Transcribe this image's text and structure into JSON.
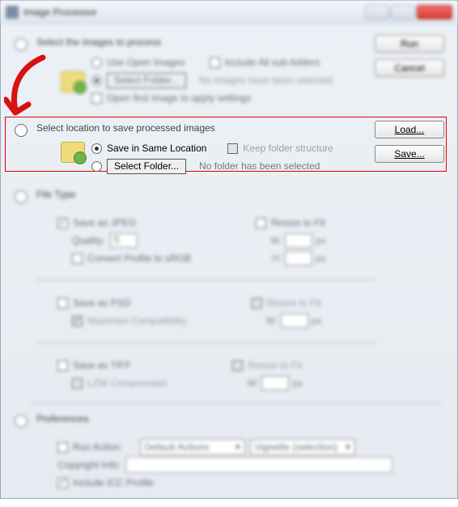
{
  "window": {
    "title": "Image Processor"
  },
  "side_buttons": {
    "run": "Run",
    "cancel": "Cancel",
    "load": "Load...",
    "save": "Save..."
  },
  "section1": {
    "title": "Select the images to process",
    "use_open_images": "Use Open Images",
    "include_subfolders": "Include All sub-folders",
    "select_folder_btn": "Select Folder...",
    "no_images": "No images have been selected",
    "open_first_image": "Open first image to apply settings"
  },
  "section2": {
    "title": "Select location to save processed images",
    "same_location": "Save in Same Location",
    "keep_folder": "Keep folder structure",
    "select_folder_btn": "Select Folder...",
    "no_folder": "No folder has been selected"
  },
  "section3": {
    "title": "File Type",
    "save_jpeg": "Save as JPEG",
    "quality_label": "Quality:",
    "quality_value": "5",
    "convert_profile": "Convert Profile to sRGB",
    "resize_fit": "Resize to Fit",
    "w_label": "W:",
    "h_label": "H:",
    "px": "px",
    "save_psd": "Save as PSD",
    "max_compat": "Maximize Compatibility",
    "resize_fit2": "Resize to Fit",
    "save_tiff": "Save as TIFF",
    "lzw": "LZW Compression",
    "resize_fit3": "Resize to Fit"
  },
  "section4": {
    "title": "Preferences",
    "run_action": "Run Action:",
    "action_set": "Default Actions",
    "action_name": "Vignette (selection)",
    "copyright": "Copyright Info:",
    "include_icc": "Include ICC Profile"
  }
}
